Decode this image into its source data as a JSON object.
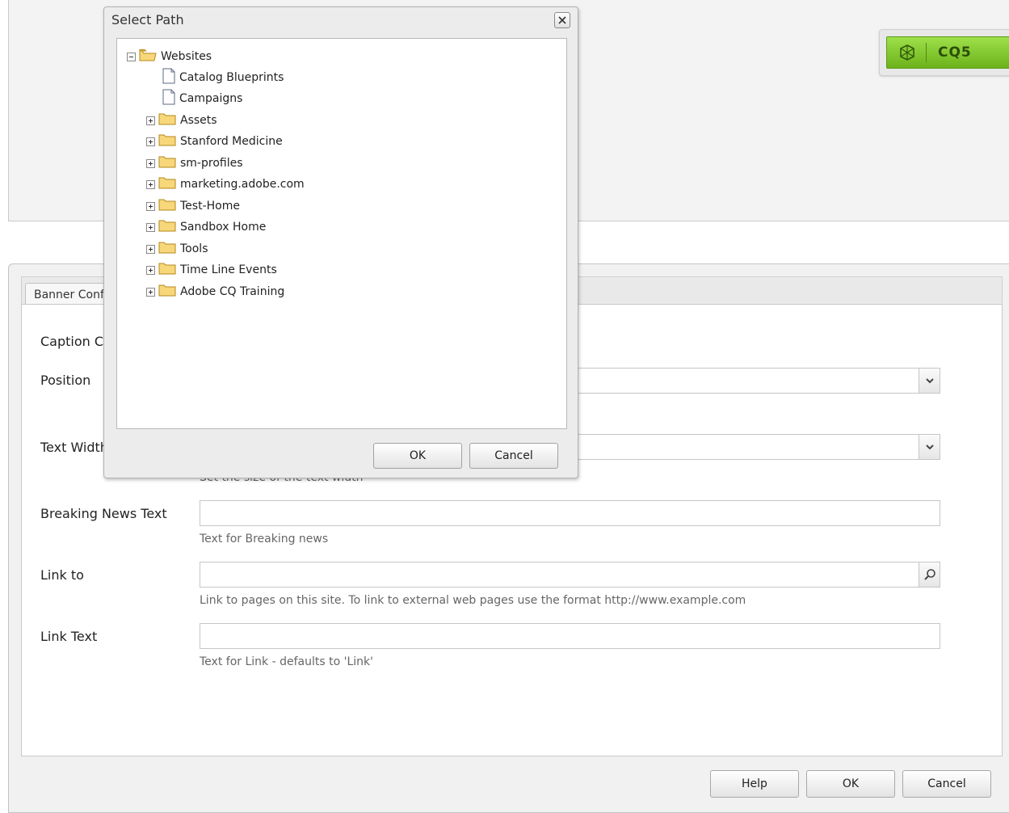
{
  "branding": {
    "product": "CQ5"
  },
  "dialog": {
    "tab_label": "Banner Configuration",
    "fields": {
      "caption": {
        "label": "Caption Configuration"
      },
      "position": {
        "label": "Position",
        "value": ""
      },
      "text_width": {
        "label": "Text Width",
        "value": "",
        "help": "Set the size of the text width"
      },
      "breaking_news": {
        "label": "Breaking News Text",
        "value": "",
        "help": "Text for Breaking news"
      },
      "link_to": {
        "label": "Link to",
        "value": "",
        "help": "Link to pages on this site. To link to external web pages use the format http://www.example.com"
      },
      "link_text": {
        "label": "Link Text",
        "value": "",
        "help": "Text for Link - defaults to 'Link'"
      }
    },
    "buttons": {
      "help": "Help",
      "ok": "OK",
      "cancel": "Cancel"
    }
  },
  "select_path": {
    "title": "Select Path",
    "root": "Websites",
    "pages": [
      "Catalog Blueprints",
      "Campaigns"
    ],
    "folders": [
      "Assets",
      "Stanford Medicine",
      "sm-profiles",
      "marketing.adobe.com",
      "Test-Home",
      "Sandbox Home",
      "Tools",
      "Time Line Events",
      "Adobe CQ Training"
    ],
    "buttons": {
      "ok": "OK",
      "cancel": "Cancel"
    }
  },
  "icons": {
    "close": "close-icon",
    "collapse": "tree-collapse-icon",
    "expand": "tree-expand-icon",
    "folder": "folder-icon",
    "page": "page-icon",
    "dropdown": "chevron-down-icon",
    "search": "search-icon",
    "logo": "cq5-logo-icon"
  }
}
